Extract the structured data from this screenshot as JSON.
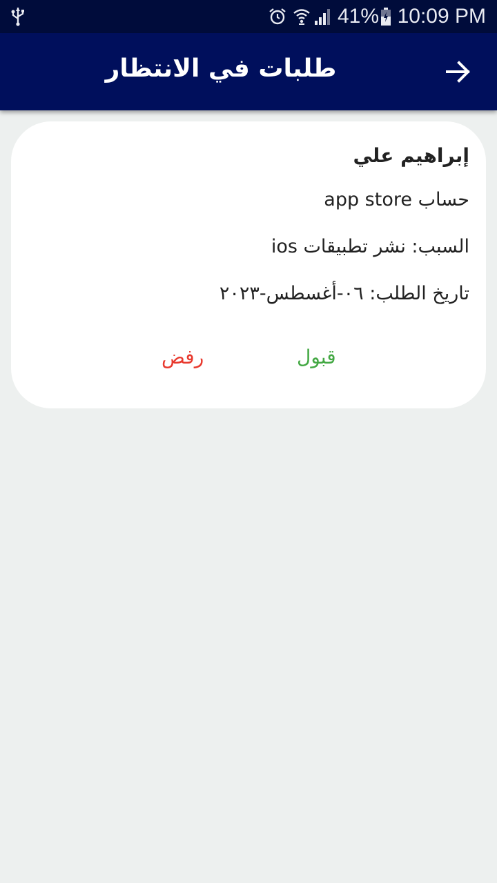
{
  "status_bar": {
    "battery_percent": "41%",
    "time": "10:09 PM",
    "icons": [
      "usb-icon",
      "alarm-icon",
      "wifi-icon",
      "signal-icon",
      "battery-icon"
    ]
  },
  "app_bar": {
    "title": "طلبات في الانتظار",
    "back_icon": "arrow-icon"
  },
  "request": {
    "name": "إبراهيم علي",
    "account": "حساب app store",
    "reason": "السبب: نشر تطبيقات ios",
    "date": "تاريخ الطلب: ٠٦-أغسطس-٢٠٢٣",
    "accept_label": "قبول",
    "reject_label": "رفض"
  },
  "colors": {
    "status_bar": "#000c3b",
    "app_bar": "#000f5c",
    "background": "#edf0ef",
    "accept": "#43a843",
    "reject": "#e8392e"
  }
}
